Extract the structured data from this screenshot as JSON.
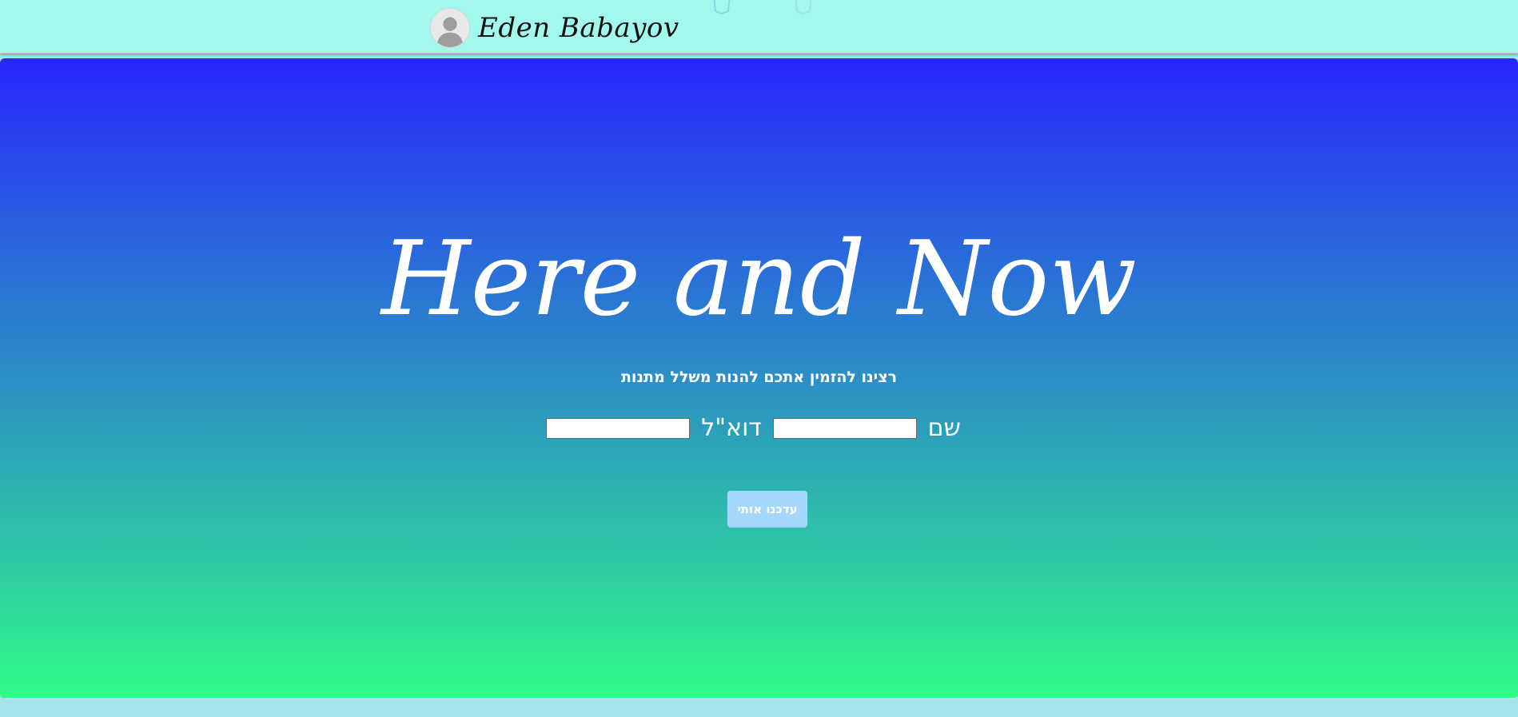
{
  "header": {
    "brand_name": "Eden Babayov",
    "avatar_icon": "user-avatar-icon",
    "faint_icons": [
      "css3-icon",
      "css3-icon"
    ]
  },
  "hero": {
    "title": "Here and Now",
    "subtitle": "רצינו להזמין אתכם להנות משלל מתנות",
    "form": {
      "name_label": "שם",
      "name_value": "",
      "email_label": "דוא\"ל",
      "email_value": "",
      "submit_label": "עדכנו אותי"
    }
  },
  "colors": {
    "header_bg": "#a3f8ee",
    "gradient_top": "#2826fd",
    "gradient_bottom": "#2ffe88",
    "button_bg": "#a7d6fb",
    "page_bg": "#a6e2ea"
  }
}
